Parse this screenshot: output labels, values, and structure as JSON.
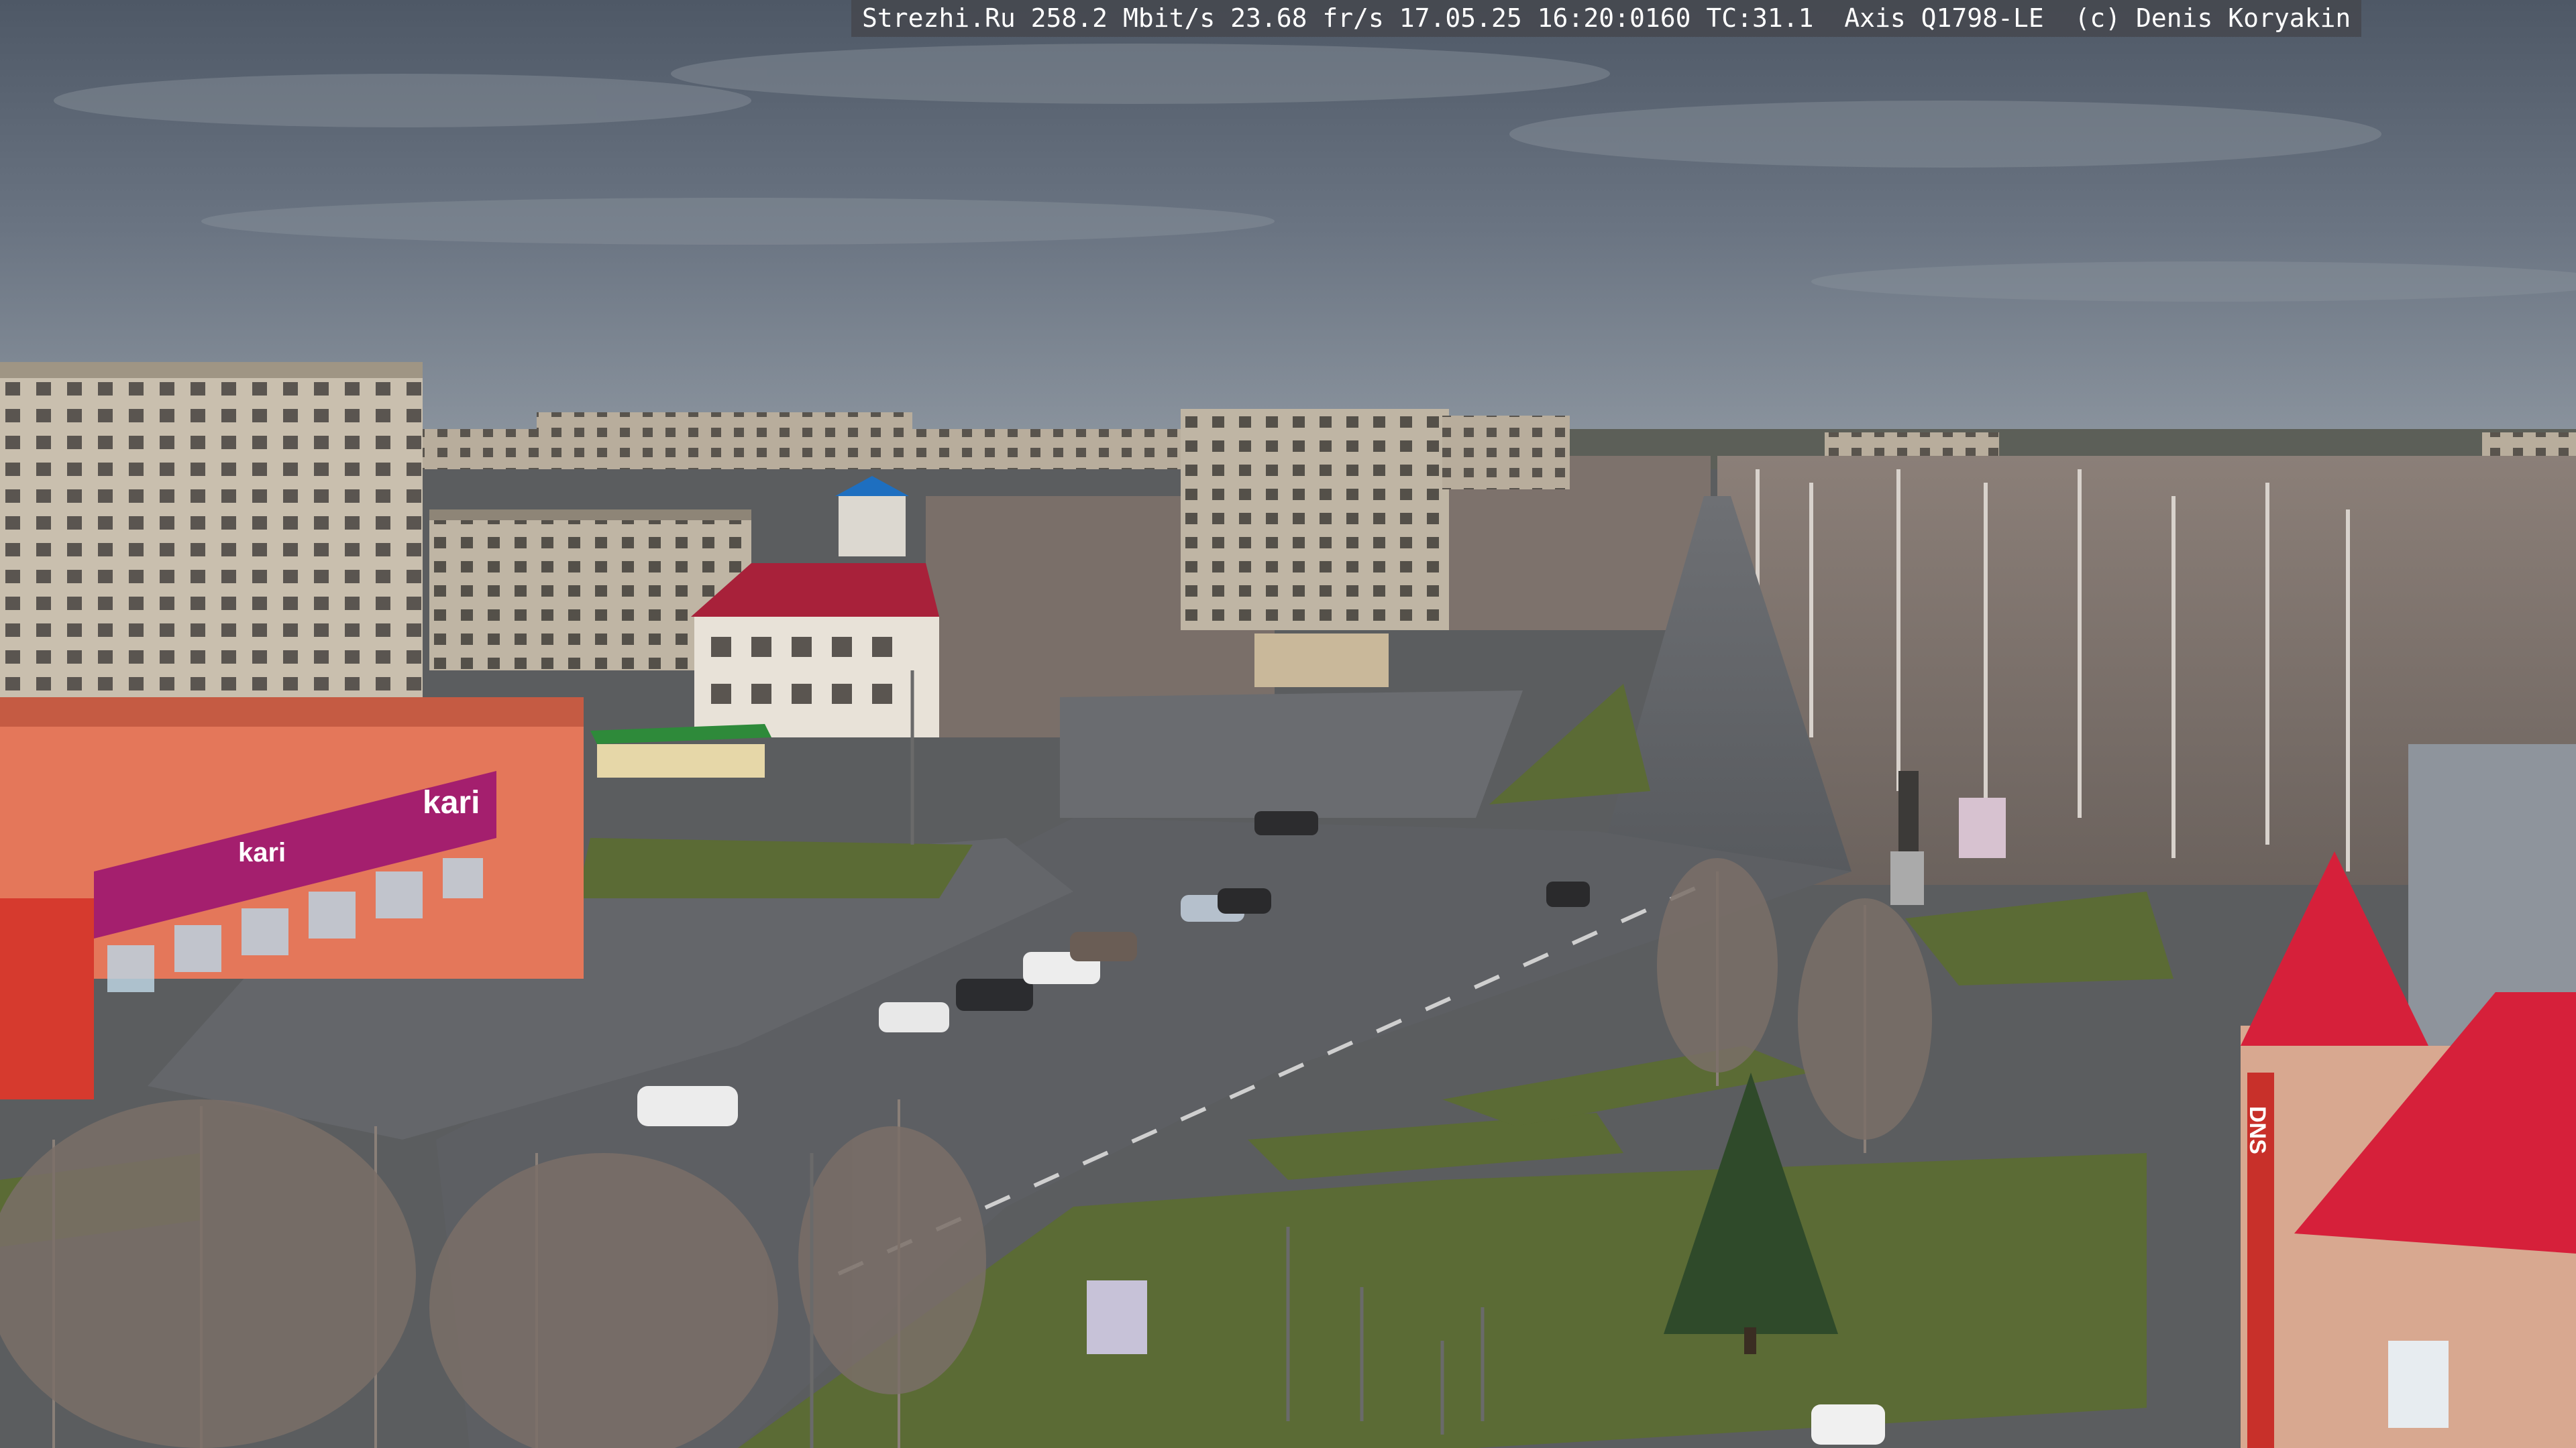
{
  "overlay": {
    "site": "Strezhi.Ru",
    "bitrate": "258.2 Mbit/s",
    "framerate": "23.68 fr/s",
    "datetime": "17.05.25 16:20:0160",
    "tc": "TC:31.1",
    "camera": "Axis Q1798-LE",
    "copyright": "(c) Denis Koryakin"
  },
  "signs": {
    "store_kari_main": "kari",
    "store_kari_small": "kari",
    "store_dns": "DNS"
  },
  "colors": {
    "sky": "#5d6876",
    "kari_magenta": "#a41f6e",
    "roof_red": "#d6203a",
    "grass": "#5b6b35",
    "asphalt": "#5a5c60"
  }
}
